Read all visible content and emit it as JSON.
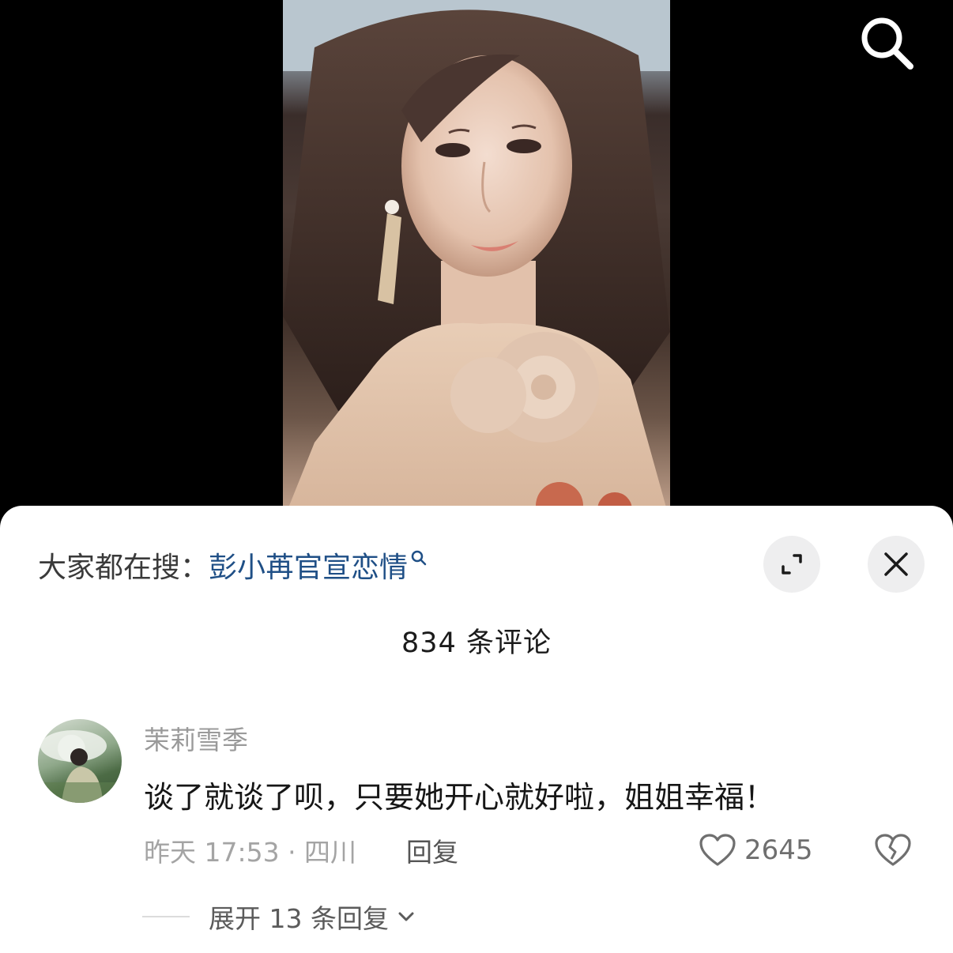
{
  "video": {
    "search_icon": "search-icon"
  },
  "sheet": {
    "hot_search_prefix": "大家都在搜：",
    "hot_search_term": "彭小苒官宣恋情",
    "comment_count_label": "834 条评论",
    "colors": {
      "hot_term": "#1f4f86",
      "sheet_bg": "#ffffff",
      "button_bg": "#eeeeef"
    }
  },
  "comment": {
    "username": "茉莉雪季",
    "text": "谈了就谈了呗，只要她开心就好啦，姐姐幸福！",
    "meta": "昨天 17:53 · 四川",
    "reply_label": "回复",
    "like_count": "2645",
    "expand_label": "展开 13 条回复"
  }
}
